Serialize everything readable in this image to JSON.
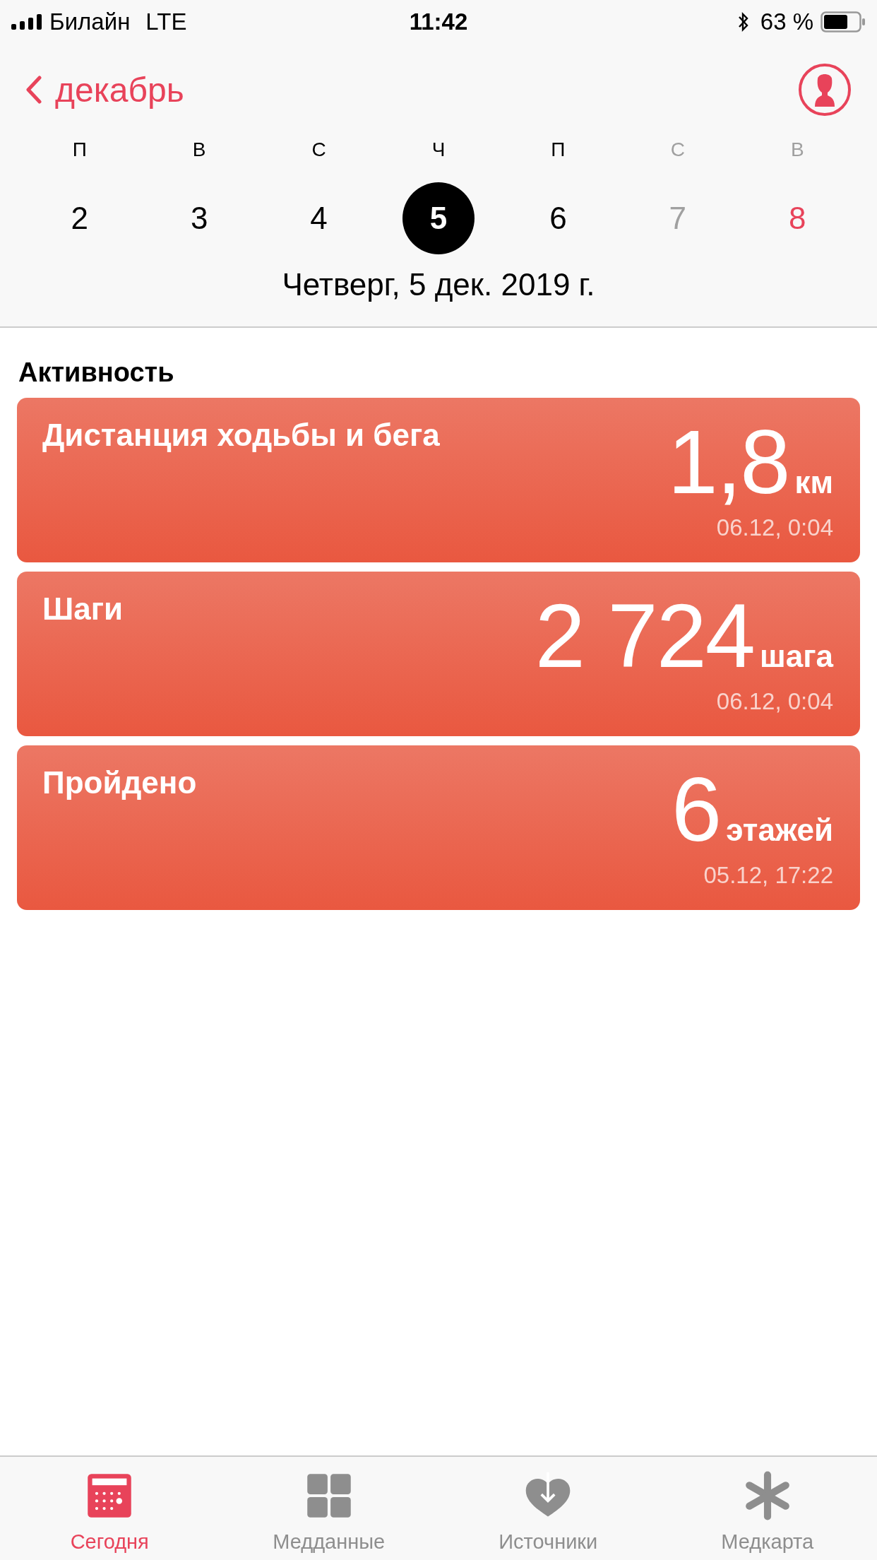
{
  "status_bar": {
    "carrier": "Билайн",
    "network": "LTE",
    "time": "11:42",
    "battery": "63 %"
  },
  "nav": {
    "back": "декабрь"
  },
  "week": [
    {
      "weekday": "П",
      "day": "2",
      "kind": "workday",
      "selected": false
    },
    {
      "weekday": "В",
      "day": "3",
      "kind": "workday",
      "selected": false
    },
    {
      "weekday": "С",
      "day": "4",
      "kind": "workday",
      "selected": false
    },
    {
      "weekday": "Ч",
      "day": "5",
      "kind": "workday",
      "selected": true
    },
    {
      "weekday": "П",
      "day": "6",
      "kind": "workday",
      "selected": false
    },
    {
      "weekday": "С",
      "day": "7",
      "kind": "saturday",
      "selected": false
    },
    {
      "weekday": "В",
      "day": "8",
      "kind": "sunday",
      "selected": false
    }
  ],
  "date_title": "Четверг, 5 дек. 2019 г.",
  "section": {
    "title": "Активность",
    "cards": [
      {
        "title": "Дистанция ходьбы и бега",
        "value": "1,8",
        "unit": "км",
        "time": "06.12, 0:04"
      },
      {
        "title": "Шаги",
        "value": "2 724",
        "unit": "шага",
        "time": "06.12, 0:04"
      },
      {
        "title": "Пройдено",
        "value": "6",
        "unit": "этажей",
        "time": "05.12, 17:22"
      }
    ]
  },
  "tabs": [
    {
      "label": "Сегодня",
      "kind": "calendar",
      "selected": true
    },
    {
      "label": "Медданные",
      "kind": "grid",
      "selected": false
    },
    {
      "label": "Источники",
      "kind": "heart",
      "selected": false
    },
    {
      "label": "Медкарта",
      "kind": "asterisk",
      "selected": false
    }
  ]
}
